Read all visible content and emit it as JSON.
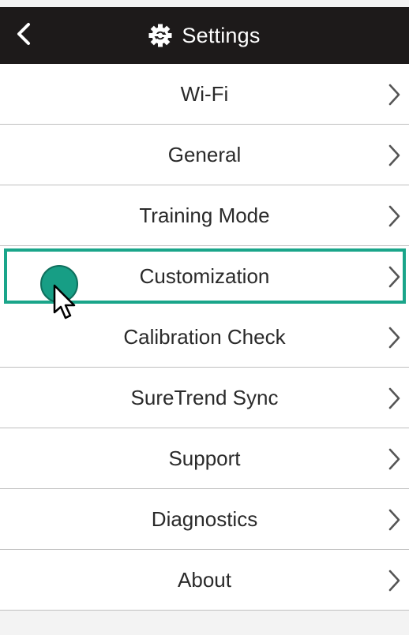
{
  "header": {
    "title": "Settings",
    "back_icon": "chevron-left-icon",
    "title_icon": "gear-icon",
    "background": "#1d1a1a"
  },
  "menu": {
    "items": [
      {
        "label": "Wi-Fi",
        "icon": "chevron-right-icon"
      },
      {
        "label": "General",
        "icon": "chevron-right-icon"
      },
      {
        "label": "Training Mode",
        "icon": "chevron-right-icon"
      },
      {
        "label": "Customization",
        "icon": "chevron-right-icon",
        "highlighted": true
      },
      {
        "label": "Calibration Check",
        "icon": "chevron-right-icon"
      },
      {
        "label": "SureTrend Sync",
        "icon": "chevron-right-icon"
      },
      {
        "label": "Support",
        "icon": "chevron-right-icon"
      },
      {
        "label": "Diagnostics",
        "icon": "chevron-right-icon"
      },
      {
        "label": "About",
        "icon": "chevron-right-icon"
      }
    ]
  },
  "annotation": {
    "highlight_color": "#1aa58a",
    "click_marker": "click-indicator",
    "cursor": "mouse-pointer-icon"
  }
}
